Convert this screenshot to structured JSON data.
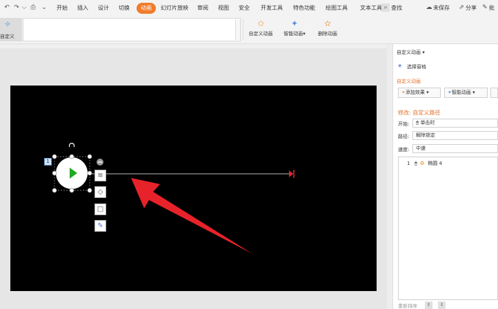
{
  "menu": {
    "items": [
      "开始",
      "插入",
      "设计",
      "切换",
      "动画",
      "幻灯片放映",
      "审阅",
      "视图",
      "安全",
      "开发工具",
      "特色功能",
      "绘图工具",
      "文本工具"
    ],
    "active_index": 4,
    "search_label": "查找",
    "unsaved_label": "未保存",
    "share_label": "分享",
    "batch_label": "批"
  },
  "ribbon": {
    "preview_label": "自定义",
    "custom_animation_label": "自定义动画",
    "smart_animation_label": "智能动画",
    "delete_animation_label": "删除动画"
  },
  "slide": {
    "badge": "1"
  },
  "pane": {
    "title": "自定义动画",
    "select_pane_label": "选择窗格",
    "section_title": "自定义动画",
    "add_effect_label": "添加效果",
    "smart_animation_label": "智能动画",
    "modify_label": "修改: 自定义路径",
    "start_label": "开始:",
    "start_value": "单击时",
    "path_label": "路径:",
    "path_value": "解除锁定",
    "speed_label": "速度:",
    "speed_value": "中速",
    "list": [
      {
        "index": "1",
        "name": "椭圆 4"
      }
    ],
    "reorder_label": "重新排序"
  },
  "colors": {
    "accent": "#f07c2c",
    "pane_heading": "#e0712c",
    "arrow": "#e8222a",
    "play": "#22a822"
  }
}
